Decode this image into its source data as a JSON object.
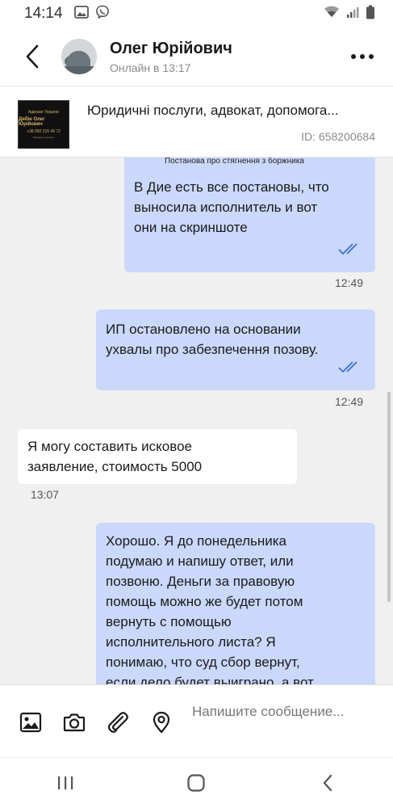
{
  "status_bar": {
    "time": "14:14",
    "icons": [
      "gallery-icon",
      "viber-icon",
      "wifi-icon",
      "signal-icon",
      "battery-icon"
    ]
  },
  "header": {
    "name": "Олег Юрійович",
    "status": "Онлайн в 13:17"
  },
  "ad": {
    "title": "Юридичні послуги, адвокат, допомога...",
    "id": "ID: 658200684",
    "thumb_text": {
      "line1": "Адвокат України",
      "line2": "Дябін Олег Юрійович",
      "line3": "+38 050 215 49 72",
      "line4": "Юридичні послуги"
    }
  },
  "messages": [
    {
      "direction": "out",
      "caption": "Постанова про стягнення з боржника",
      "lines": [
        "В Дие есть все постановы, что",
        "выносила исполнитель и вот",
        "они на скриншоте"
      ],
      "time": "12:49",
      "read": true
    },
    {
      "direction": "out",
      "lines": [
        "ИП остановлено на основании",
        "ухвалы про забезпечення позову."
      ],
      "time": "12:49",
      "read": true
    },
    {
      "direction": "in",
      "lines": [
        "Я могу составить исковое",
        "заявление, стоимость 5000"
      ],
      "time": "13:07"
    },
    {
      "direction": "out",
      "lines": [
        "Хорошо. Я до понедельника",
        "подумаю и напишу ответ, или",
        "позвоню. Деньги за правовую",
        "помощь можно же будет потом",
        "вернуть с помощью",
        "исполнительного листа? Я",
        "понимаю, что суд сбор вернут,",
        "если дело будет выиграно, а вот"
      ]
    }
  ],
  "compose": {
    "placeholder": "Напишите сообщение..."
  },
  "colors": {
    "outgoing_bubble": "#cad8fb",
    "incoming_bubble": "#ffffff",
    "tick": "#3d6fd6",
    "chat_bg": "#f0f0f0"
  }
}
